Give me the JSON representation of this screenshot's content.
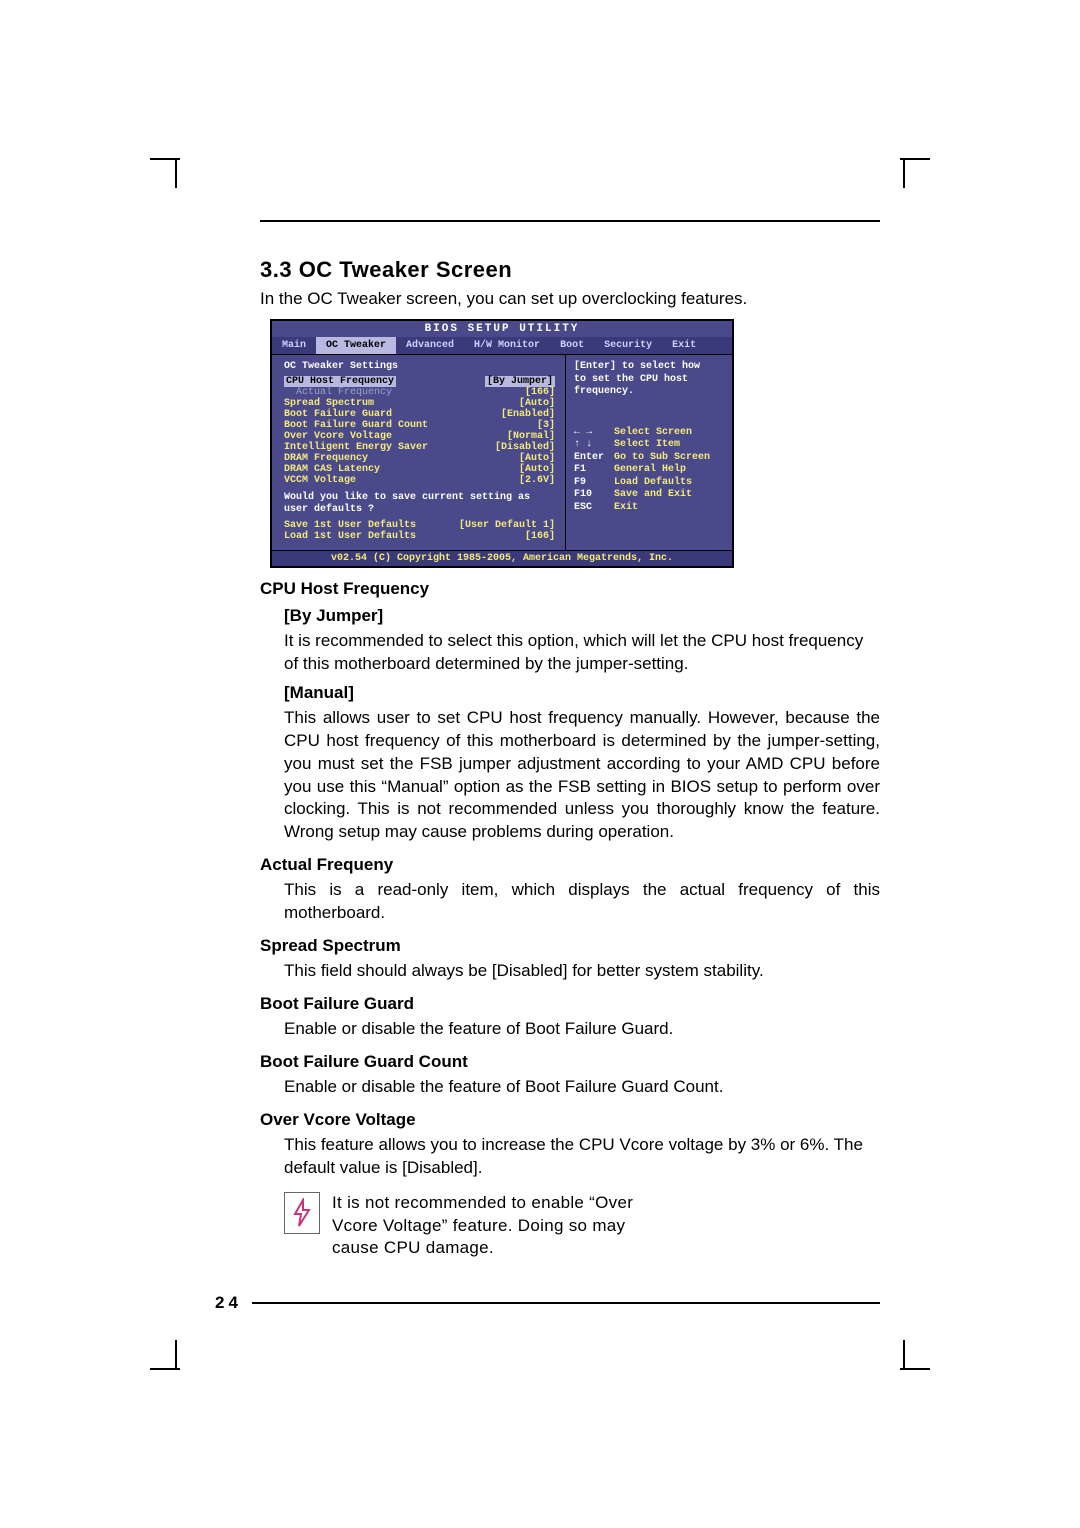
{
  "section_title": "3.3 OC Tweaker Screen",
  "intro": "In the OC Tweaker screen, you can set up overclocking features.",
  "page_number": "24",
  "bios": {
    "title": "BIOS SETUP UTILITY",
    "tabs": [
      "Main",
      "OC Tweaker",
      "Advanced",
      "H/W Monitor",
      "Boot",
      "Security",
      "Exit"
    ],
    "active_tab": "OC Tweaker",
    "header": "OC Tweaker Settings",
    "rows": [
      {
        "label": "CPU Host Frequency",
        "value": "[By Jumper]",
        "highlight": true
      },
      {
        "label": "  Actual Frequency",
        "value": "[166]",
        "indent": true
      },
      {
        "label": "Spread Spectrum",
        "value": "[Auto]"
      },
      {
        "label": "Boot Failure Guard",
        "value": "[Enabled]"
      },
      {
        "label": "Boot Failure Guard Count",
        "value": "[3]"
      },
      {
        "label": "Over Vcore Voltage",
        "value": "[Normal]"
      },
      {
        "label": "Intelligent Energy Saver",
        "value": "[Disabled]"
      },
      {
        "label": "DRAM Frequency",
        "value": "[Auto]"
      },
      {
        "label": "DRAM CAS Latency",
        "value": "[Auto]"
      },
      {
        "label": "VCCM Voltage",
        "value": "[2.6V]"
      }
    ],
    "prompt_line1": "Would you like to save current setting as",
    "prompt_line2": "user defaults ?",
    "save_rows": [
      {
        "label": "Save 1st User Defaults",
        "value": "[User Default 1]"
      },
      {
        "label": "Load 1st User Defaults",
        "value": "[166]"
      }
    ],
    "help_line1": "[Enter] to select how",
    "help_line2": "to set the CPU host",
    "help_line3": "frequency.",
    "keys": [
      {
        "k": "← →",
        "d": "Select Screen"
      },
      {
        "k": "↑ ↓",
        "d": "Select Item"
      },
      {
        "k": "Enter",
        "d": "Go to Sub Screen"
      },
      {
        "k": "F1",
        "d": "General Help"
      },
      {
        "k": "F9",
        "d": "Load Defaults"
      },
      {
        "k": "F10",
        "d": "Save and Exit"
      },
      {
        "k": "ESC",
        "d": "Exit"
      }
    ],
    "footer": "v02.54 (C) Copyright 1985-2005, American Megatrends, Inc."
  },
  "doc": {
    "h_cpu": "CPU Host Frequency",
    "h_byjumper": "[By Jumper]",
    "p_byjumper": "It is recommended to select this option, which will let the CPU host frequency of this motherboard determined by the jumper-setting.",
    "h_manual": "[Manual]",
    "p_manual": "This allows user to set CPU host frequency manually. However, because the CPU host frequency of this motherboard is determined by the jumper-setting, you must set the FSB jumper adjustment according to your AMD CPU before you use this “Manual” option as the FSB setting in BIOS setup to perform over clocking. This is not recommended unless you thoroughly know the feature. Wrong setup may cause problems during operation.",
    "h_actual": "Actual Frequeny",
    "p_actual": "This is a read-only item, which displays the actual frequency of this motherboard.",
    "h_spread": "Spread Spectrum",
    "p_spread": "This field should always be [Disabled] for better system stability.",
    "h_bfg": "Boot Failure Guard",
    "p_bfg": "Enable or disable the feature of Boot Failure Guard.",
    "h_bfgc": "Boot Failure Guard Count",
    "p_bfgc": "Enable or disable the feature of Boot Failure Guard Count.",
    "h_ov": "Over Vcore Voltage",
    "p_ov": "This feature allows you to increase the CPU Vcore voltage by 3% or 6%. The default value is [Disabled].",
    "note": "It is not recommended to enable “Over Vcore Voltage” feature. Doing so may cause CPU damage."
  }
}
